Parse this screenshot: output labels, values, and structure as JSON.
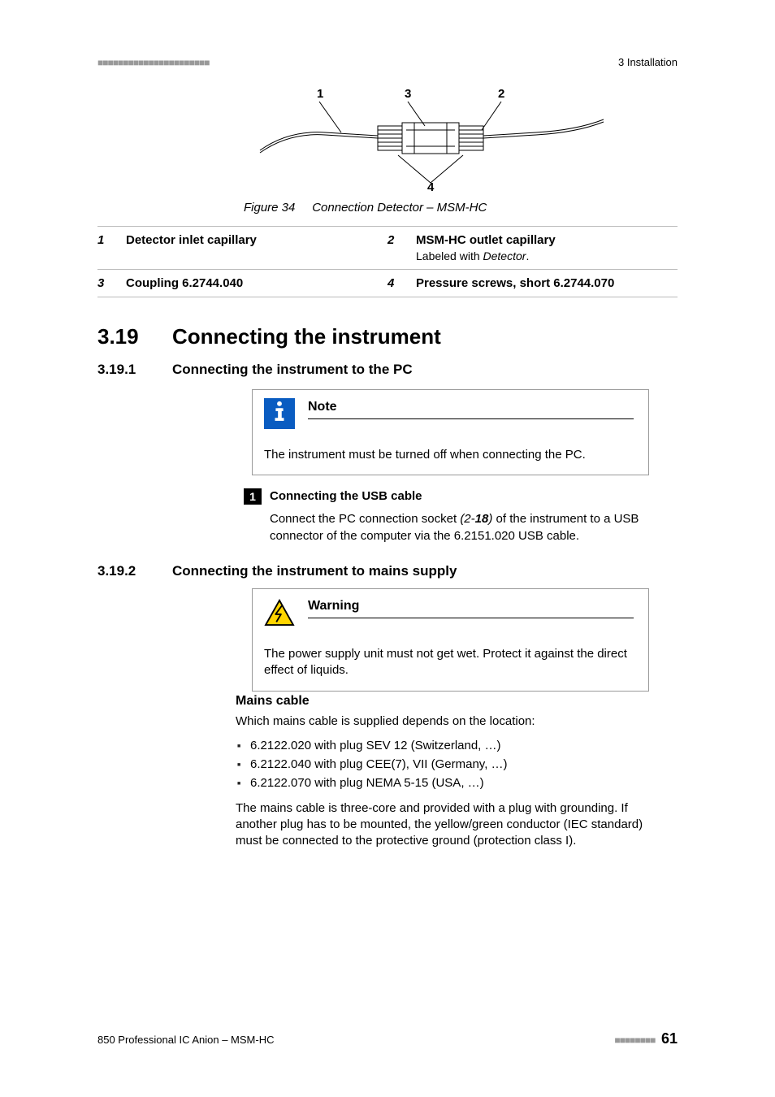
{
  "header": {
    "ticks": "■■■■■■■■■■■■■■■■■■■■■■",
    "section_label": "3 Installation"
  },
  "figure": {
    "callouts": {
      "n1": "1",
      "n2": "2",
      "n3": "3",
      "n4": "4"
    },
    "caption_label": "Figure 34",
    "caption_text": "Connection Detector – MSM-HC"
  },
  "legend": {
    "r1c1_num": "1",
    "r1c1_txt": "Detector inlet capillary",
    "r1c2_num": "2",
    "r1c2_txt": "MSM-HC outlet capillary",
    "r1c2_sub_pre": "Labeled with ",
    "r1c2_sub_em": "Detector",
    "r1c2_sub_post": ".",
    "r2c1_num": "3",
    "r2c1_txt": "Coupling 6.2744.040",
    "r2c2_num": "4",
    "r2c2_txt": "Pressure screws, short 6.2744.070"
  },
  "sec": {
    "num": "3.19",
    "title": "Connecting the instrument"
  },
  "sub1": {
    "num": "3.19.1",
    "title": "Connecting the instrument to the PC"
  },
  "note": {
    "title": "Note",
    "body": "The instrument must be turned off when connecting the PC."
  },
  "step": {
    "num": "1",
    "title": "Connecting the USB cable",
    "body_pre": "Connect the PC connection socket ",
    "body_ref_open": "(2-",
    "body_ref_num": "18",
    "body_ref_close": ")",
    "body_post": " of the instrument to a USB connector of the computer via the 6.2151.020 USB cable."
  },
  "sub2": {
    "num": "3.19.2",
    "title": "Connecting the instrument to mains supply"
  },
  "warning": {
    "title": "Warning",
    "body": "The power supply unit must not get wet. Protect it against the direct effect of liquids."
  },
  "mains": {
    "heading": "Mains cable",
    "intro": "Which mains cable is supplied depends on the location:",
    "items": [
      "6.2122.020 with plug SEV 12 (Switzerland, …)",
      "6.2122.040 with plug CEE(7), VII (Germany, …)",
      "6.2122.070 with plug NEMA 5-15 (USA, …)"
    ],
    "para": "The mains cable is three-core and provided with a plug with grounding. If another plug has to be mounted, the yellow/green conductor (IEC standard) must be connected to the protective ground (protection class I)."
  },
  "footer": {
    "doc": "850 Professional IC Anion – MSM-HC",
    "ticks": "■■■■■■■■",
    "page": "61"
  }
}
